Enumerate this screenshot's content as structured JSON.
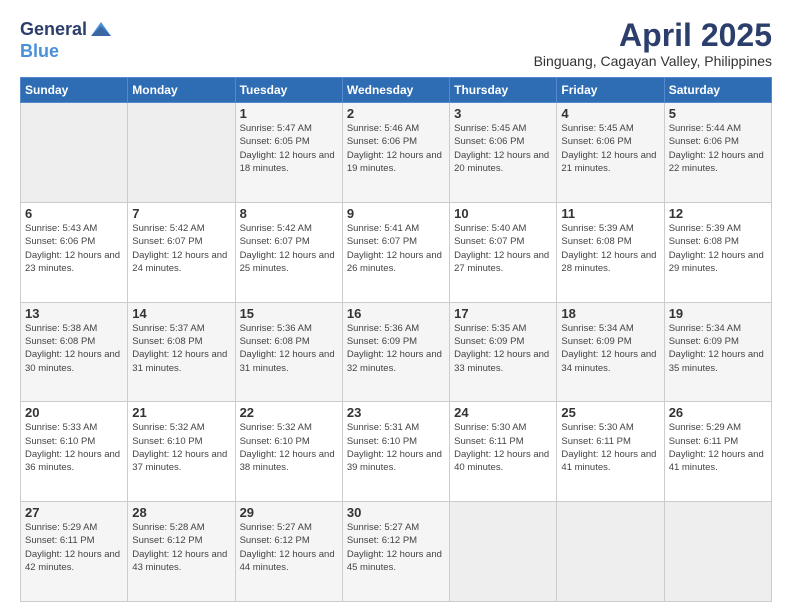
{
  "header": {
    "logo_general": "General",
    "logo_blue": "Blue",
    "title": "April 2025",
    "location": "Binguang, Cagayan Valley, Philippines"
  },
  "weekdays": [
    "Sunday",
    "Monday",
    "Tuesday",
    "Wednesday",
    "Thursday",
    "Friday",
    "Saturday"
  ],
  "weeks": [
    [
      {
        "day": "",
        "info": ""
      },
      {
        "day": "",
        "info": ""
      },
      {
        "day": "1",
        "info": "Sunrise: 5:47 AM\nSunset: 6:05 PM\nDaylight: 12 hours\nand 18 minutes."
      },
      {
        "day": "2",
        "info": "Sunrise: 5:46 AM\nSunset: 6:06 PM\nDaylight: 12 hours\nand 19 minutes."
      },
      {
        "day": "3",
        "info": "Sunrise: 5:45 AM\nSunset: 6:06 PM\nDaylight: 12 hours\nand 20 minutes."
      },
      {
        "day": "4",
        "info": "Sunrise: 5:45 AM\nSunset: 6:06 PM\nDaylight: 12 hours\nand 21 minutes."
      },
      {
        "day": "5",
        "info": "Sunrise: 5:44 AM\nSunset: 6:06 PM\nDaylight: 12 hours\nand 22 minutes."
      }
    ],
    [
      {
        "day": "6",
        "info": "Sunrise: 5:43 AM\nSunset: 6:06 PM\nDaylight: 12 hours\nand 23 minutes."
      },
      {
        "day": "7",
        "info": "Sunrise: 5:42 AM\nSunset: 6:07 PM\nDaylight: 12 hours\nand 24 minutes."
      },
      {
        "day": "8",
        "info": "Sunrise: 5:42 AM\nSunset: 6:07 PM\nDaylight: 12 hours\nand 25 minutes."
      },
      {
        "day": "9",
        "info": "Sunrise: 5:41 AM\nSunset: 6:07 PM\nDaylight: 12 hours\nand 26 minutes."
      },
      {
        "day": "10",
        "info": "Sunrise: 5:40 AM\nSunset: 6:07 PM\nDaylight: 12 hours\nand 27 minutes."
      },
      {
        "day": "11",
        "info": "Sunrise: 5:39 AM\nSunset: 6:08 PM\nDaylight: 12 hours\nand 28 minutes."
      },
      {
        "day": "12",
        "info": "Sunrise: 5:39 AM\nSunset: 6:08 PM\nDaylight: 12 hours\nand 29 minutes."
      }
    ],
    [
      {
        "day": "13",
        "info": "Sunrise: 5:38 AM\nSunset: 6:08 PM\nDaylight: 12 hours\nand 30 minutes."
      },
      {
        "day": "14",
        "info": "Sunrise: 5:37 AM\nSunset: 6:08 PM\nDaylight: 12 hours\nand 31 minutes."
      },
      {
        "day": "15",
        "info": "Sunrise: 5:36 AM\nSunset: 6:08 PM\nDaylight: 12 hours\nand 31 minutes."
      },
      {
        "day": "16",
        "info": "Sunrise: 5:36 AM\nSunset: 6:09 PM\nDaylight: 12 hours\nand 32 minutes."
      },
      {
        "day": "17",
        "info": "Sunrise: 5:35 AM\nSunset: 6:09 PM\nDaylight: 12 hours\nand 33 minutes."
      },
      {
        "day": "18",
        "info": "Sunrise: 5:34 AM\nSunset: 6:09 PM\nDaylight: 12 hours\nand 34 minutes."
      },
      {
        "day": "19",
        "info": "Sunrise: 5:34 AM\nSunset: 6:09 PM\nDaylight: 12 hours\nand 35 minutes."
      }
    ],
    [
      {
        "day": "20",
        "info": "Sunrise: 5:33 AM\nSunset: 6:10 PM\nDaylight: 12 hours\nand 36 minutes."
      },
      {
        "day": "21",
        "info": "Sunrise: 5:32 AM\nSunset: 6:10 PM\nDaylight: 12 hours\nand 37 minutes."
      },
      {
        "day": "22",
        "info": "Sunrise: 5:32 AM\nSunset: 6:10 PM\nDaylight: 12 hours\nand 38 minutes."
      },
      {
        "day": "23",
        "info": "Sunrise: 5:31 AM\nSunset: 6:10 PM\nDaylight: 12 hours\nand 39 minutes."
      },
      {
        "day": "24",
        "info": "Sunrise: 5:30 AM\nSunset: 6:11 PM\nDaylight: 12 hours\nand 40 minutes."
      },
      {
        "day": "25",
        "info": "Sunrise: 5:30 AM\nSunset: 6:11 PM\nDaylight: 12 hours\nand 41 minutes."
      },
      {
        "day": "26",
        "info": "Sunrise: 5:29 AM\nSunset: 6:11 PM\nDaylight: 12 hours\nand 41 minutes."
      }
    ],
    [
      {
        "day": "27",
        "info": "Sunrise: 5:29 AM\nSunset: 6:11 PM\nDaylight: 12 hours\nand 42 minutes."
      },
      {
        "day": "28",
        "info": "Sunrise: 5:28 AM\nSunset: 6:12 PM\nDaylight: 12 hours\nand 43 minutes."
      },
      {
        "day": "29",
        "info": "Sunrise: 5:27 AM\nSunset: 6:12 PM\nDaylight: 12 hours\nand 44 minutes."
      },
      {
        "day": "30",
        "info": "Sunrise: 5:27 AM\nSunset: 6:12 PM\nDaylight: 12 hours\nand 45 minutes."
      },
      {
        "day": "",
        "info": ""
      },
      {
        "day": "",
        "info": ""
      },
      {
        "day": "",
        "info": ""
      }
    ]
  ]
}
